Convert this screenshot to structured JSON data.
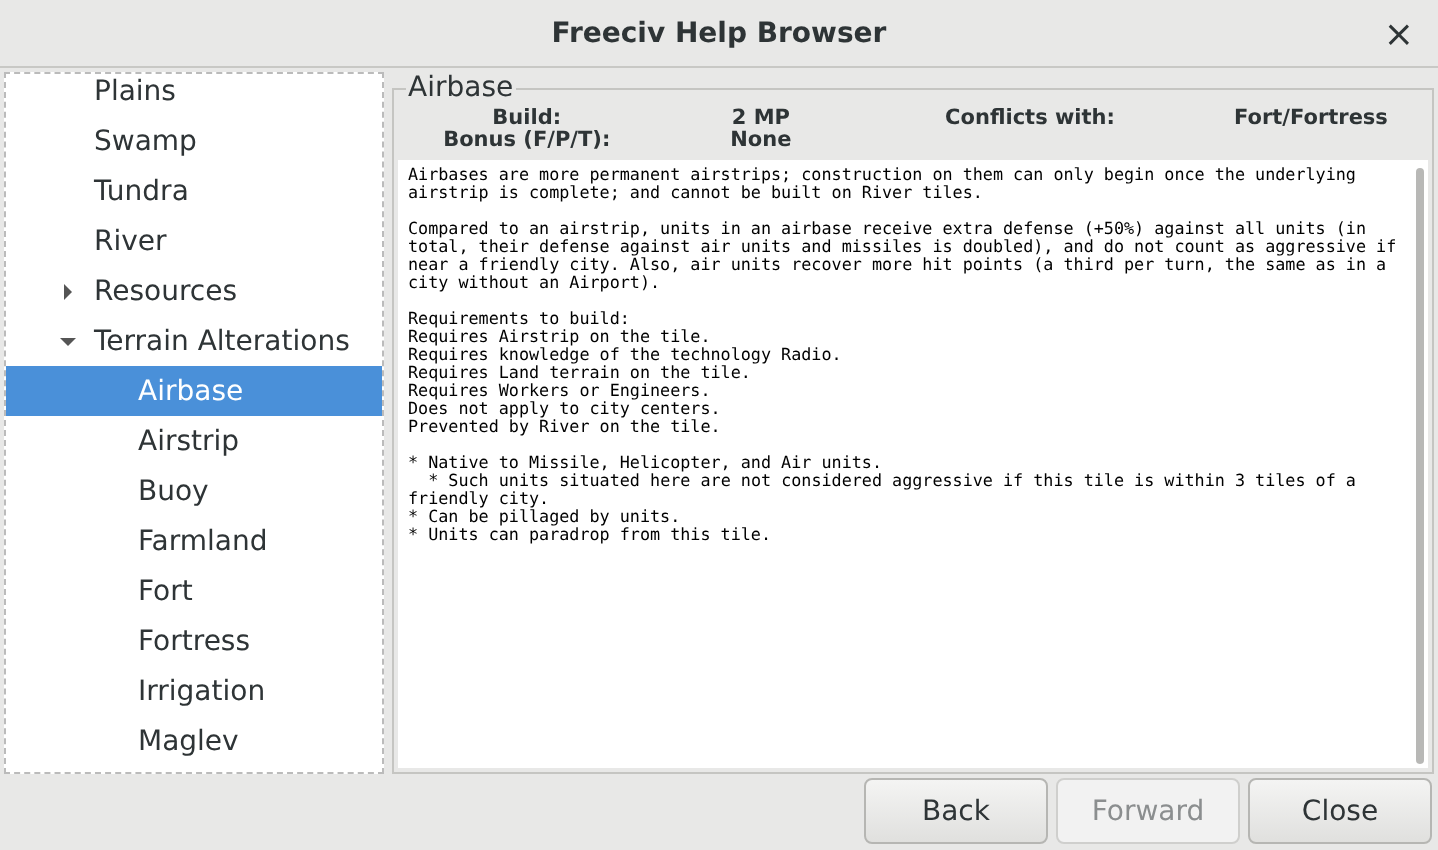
{
  "window": {
    "title": "Freeciv Help Browser",
    "close": "×"
  },
  "tree": [
    {
      "label": "Plains",
      "selected": false
    },
    {
      "label": "Swamp",
      "selected": false
    },
    {
      "label": "Tundra",
      "selected": false
    },
    {
      "label": "River",
      "selected": false
    },
    {
      "label": "Resources",
      "selected": false,
      "expanded": false
    },
    {
      "label": "Terrain Alterations",
      "selected": false,
      "expanded": true,
      "children": [
        {
          "label": "Airbase",
          "selected": true
        },
        {
          "label": "Airstrip",
          "selected": false
        },
        {
          "label": "Buoy",
          "selected": false
        },
        {
          "label": "Farmland",
          "selected": false
        },
        {
          "label": "Fort",
          "selected": false
        },
        {
          "label": "Fortress",
          "selected": false
        },
        {
          "label": "Irrigation",
          "selected": false
        },
        {
          "label": "Maglev",
          "selected": false
        }
      ]
    }
  ],
  "detail": {
    "title": "Airbase",
    "properties": [
      {
        "label": "Build:",
        "value": "2 MP"
      },
      {
        "label": "Conflicts with:",
        "value": "Fort/Fortress"
      },
      {
        "label": "Bonus (F/P/T):",
        "value": "None"
      }
    ],
    "paragraphs": [
      "Airbases are more permanent airstrips; construction on them can only begin once the underlying\nairstrip is complete; and cannot be built on River tiles.",
      "Compared to an airstrip, units in an airbase receive extra defense (+50%) against all units (in\ntotal, their defense against air units and missiles is doubled), and do not count as aggressive if\nnear a friendly city. Also, air units recover more hit points (a third per turn, the same as in a\ncity without an Airport).",
      "Requirements to build:\nRequires Airstrip on the tile.\nRequires knowledge of the technology Radio.\nRequires Land terrain on the tile.\nRequires Workers or Engineers.\nDoes not apply to city centers.\nPrevented by River on the tile.",
      "* Native to Missile, Helicopter, and Air units.\n  * Such units situated here are not considered aggressive if this tile is within 3 tiles of a\nfriendly city.\n* Can be pillaged by units.\n* Units can paradrop from this tile."
    ]
  },
  "buttons": [
    {
      "label": "Back",
      "disabled": false
    },
    {
      "label": "Forward",
      "disabled": true
    },
    {
      "label": "Close",
      "disabled": false
    }
  ]
}
